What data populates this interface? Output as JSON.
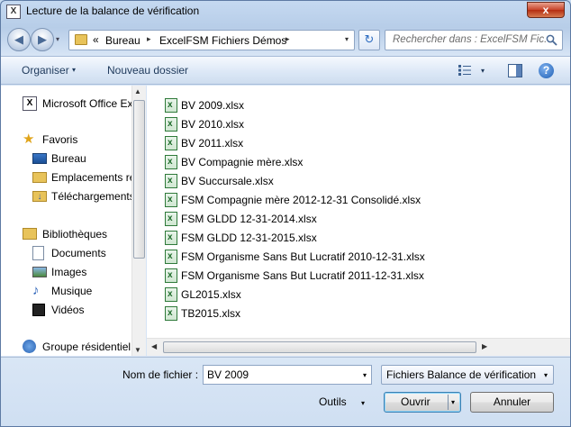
{
  "window": {
    "title": "Lecture de la balance de vérification",
    "close_label": "x",
    "app_icon_letter": "X"
  },
  "address": {
    "prefix": "«",
    "crumbs": [
      "Bureau",
      "ExcelFSM Fichiers Démos"
    ],
    "separator": "▸",
    "dropdown": "▾",
    "refresh": "↻",
    "search_placeholder": "Rechercher dans : ExcelFSM Fic..."
  },
  "toolbar": {
    "organise_label": "Organiser",
    "new_folder_label": "Nouveau dossier",
    "dropdown": "▾",
    "help_label": "?"
  },
  "nav": {
    "items": [
      {
        "label": "Microsoft Office Ex",
        "icon": "excel-icon",
        "level": "top"
      },
      {
        "label": "Favoris",
        "icon": "star-icon",
        "level": "top"
      },
      {
        "label": "Bureau",
        "icon": "desktop-icon",
        "level": "sub"
      },
      {
        "label": "Emplacements ré",
        "icon": "recent-places-icon",
        "level": "sub"
      },
      {
        "label": "Téléchargements",
        "icon": "downloads-icon",
        "level": "sub"
      },
      {
        "label": "Bibliothèques",
        "icon": "libraries-icon",
        "level": "top"
      },
      {
        "label": "Documents",
        "icon": "documents-icon",
        "level": "sub"
      },
      {
        "label": "Images",
        "icon": "pictures-icon",
        "level": "sub"
      },
      {
        "label": "Musique",
        "icon": "music-icon",
        "level": "sub"
      },
      {
        "label": "Vidéos",
        "icon": "videos-icon",
        "level": "sub"
      },
      {
        "label": "Groupe résidentiel",
        "icon": "homegroup-icon",
        "level": "top"
      }
    ]
  },
  "files": [
    "BV 2009.xlsx",
    "BV 2010.xlsx",
    "BV 2011.xlsx",
    "BV Compagnie mère.xlsx",
    "BV Succursale.xlsx",
    "FSM  Compagnie mère 2012-12-31 Consolidé.xlsx",
    "FSM GLDD 12-31-2014.xlsx",
    "FSM GLDD 12-31-2015.xlsx",
    "FSM Organisme Sans But Lucratif 2010-12-31.xlsx",
    "FSM Organisme Sans But Lucratif 2011-12-31.xlsx",
    "GL2015.xlsx",
    "TB2015.xlsx"
  ],
  "bottom": {
    "filename_label": "Nom de fichier :",
    "filename_value": "BV 2009",
    "filetype_value": "Fichiers Balance de vérification",
    "tools_label": "Outils",
    "open_label": "Ouvrir",
    "cancel_label": "Annuler",
    "dropdown": "▾"
  },
  "scroll": {
    "up": "▲",
    "down": "▼",
    "left": "◀",
    "right": "▶",
    "grip": "⦙"
  },
  "colors": {
    "accent": "#1e395b",
    "excel_green": "#1d6b2a"
  }
}
